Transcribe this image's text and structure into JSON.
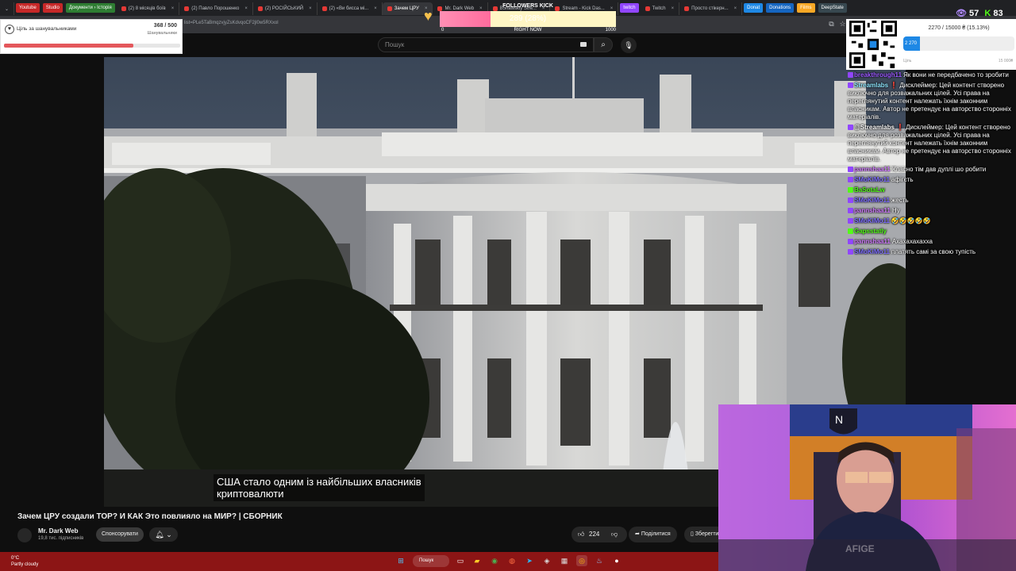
{
  "browser": {
    "tabs": [
      {
        "label": "Youtube",
        "chip": "#c62828"
      },
      {
        "label": "Studio",
        "chip": "#c62828"
      },
      {
        "label": "Документи › Історія",
        "chip": "#2e7d32"
      },
      {
        "label": "(2) 8 місяців боїв"
      },
      {
        "label": "(2) Павло Порошенко"
      },
      {
        "label": "(2) РОСІЙСЬКИЙ"
      },
      {
        "label": "(2) «Ви бисса мі..."
      },
      {
        "label": "Зачем ЦРУ",
        "active": true
      },
      {
        "label": "Mr. Dark Web"
      },
      {
        "label": "B5hawskiy Stre..."
      },
      {
        "label": "Stream - Kick Das..."
      },
      {
        "label": "twitch",
        "chip": "#9146ff"
      },
      {
        "label": "Twitch"
      },
      {
        "label": "Просто стікерн..."
      },
      {
        "label": "Donat",
        "chip": "#1e88e5"
      },
      {
        "label": "Donations",
        "chip": "#1565c0"
      },
      {
        "label": "Films",
        "chip": "#f9a825"
      },
      {
        "label": "DeepState",
        "chip": "#37474f"
      }
    ],
    "url": "list=PLe5TaBmqzvjyZsKdvqoCF2jl0w5RXxol"
  },
  "youtube": {
    "search_placeholder": "Пошук",
    "subtitle_line1": "США стало одним із найбільших власників",
    "subtitle_line2": "криптовалюти",
    "video_title": "Зачем ЦРУ создали ТОР? И КАК Это повлияло на МИР? | СБОРНИК",
    "channel_name": "Mr. Dark Web",
    "subscribers": "19,8 тис. підписників",
    "sponsor_label": "Спонсорувати",
    "likes": "224",
    "share_label": "Поділитися",
    "save_label": "Зберегти"
  },
  "overlays": {
    "sub_goal": {
      "title": "Ціль за шанувальниками",
      "count": "368 / 500",
      "unit": "Шанувальники",
      "progress": 0.736
    },
    "follow_goal": {
      "label": "FOLLOWERS KICK",
      "count": "289 (28%)",
      "min": "0",
      "center": "RIGHT NOW",
      "max": "1000",
      "progress": 0.289
    },
    "viewers": {
      "twitch": "57",
      "kick": "83"
    },
    "donation": {
      "progress_text": "2270 / 15000 ₴ (15.13%)",
      "bar_label": "2 270",
      "min_label": "Ціль",
      "max_label": "15 000₴",
      "progress": 0.1513
    }
  },
  "chat": [
    {
      "user": "breakthrough11",
      "text": "Як вони не передбачено то зробити",
      "color": "#9b59ff"
    },
    {
      "user": "Streamlabs",
      "text": "❗ Дисклеймер: Цей контент створено виключно для розважальних цілей. Усі права на переглянутий контент належать їхнім законним власникам. Автор не претендує на авторство сторонніх матеріалів.",
      "color": "#8ee6ff"
    },
    {
      "user": "@Streamlabs",
      "text": "❗ Дисклеймер: Цей контент створено виключно для розважальних цілей. Усі права на переглянутий контент належать їхнім законним власникам. Автор не претендує на авторство сторонніх матеріалів.",
      "color": "#ffffff"
    },
    {
      "user": "pannshaa11",
      "text": "Класно тім дав дуплі шо робити",
      "color": "#d17cff"
    },
    {
      "user": "SMoKiMo11",
      "text": "афігєть",
      "color": "#7c6cff"
    },
    {
      "user": "BaSotaLw",
      "text": "",
      "color": "#53fc18"
    },
    {
      "user": "SMoKiMo11",
      "text": "жесть",
      "color": "#7c6cff"
    },
    {
      "user": "pannshaa11",
      "text": "Ну",
      "color": "#d17cff"
    },
    {
      "user": "SMoKiMo11",
      "text": "🤣🤣🤣🤣🤣",
      "color": "#7c6cff"
    },
    {
      "user": "Gapsstatly",
      "text": "",
      "color": "#53fc18"
    },
    {
      "user": "pannshaa11",
      "text": "Ахахахахахха",
      "color": "#d17cff"
    },
    {
      "user": "SMoKiMo11",
      "text": "платять самі за свою тупість",
      "color": "#7c6cff"
    }
  ],
  "taskbar": {
    "temp": "0°C",
    "weather": "Partly cloudy",
    "search": "Пошук"
  }
}
